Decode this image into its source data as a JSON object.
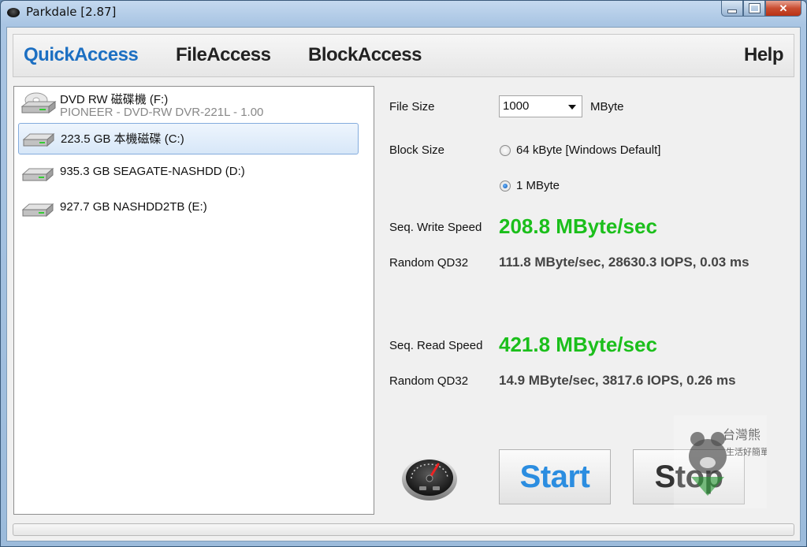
{
  "window": {
    "title": "Parkdale [2.87]"
  },
  "tabs": [
    {
      "label": "QuickAccess",
      "active": true
    },
    {
      "label": "FileAccess"
    },
    {
      "label": "BlockAccess"
    }
  ],
  "help_label": "Help",
  "drives": [
    {
      "name": "DVD RW 磁碟機 (F:)",
      "sub": "PIONEER - DVD-RW  DVR-221L - 1.00",
      "icon": "dvd-drive-icon"
    },
    {
      "name": "223.5 GB 本機磁碟 (C:)",
      "icon": "hard-disk-icon",
      "selected": true
    },
    {
      "name": "935.3 GB SEAGATE-NASHDD (D:)",
      "icon": "hard-disk-icon"
    },
    {
      "name": "927.7 GB NASHDD2TB (E:)",
      "icon": "hard-disk-icon"
    }
  ],
  "settings": {
    "file_size_label": "File Size",
    "file_size_value": "1000",
    "file_size_unit": "MByte",
    "block_size_label": "Block Size",
    "block_options": [
      {
        "label": "64 kByte [Windows Default]",
        "checked": false
      },
      {
        "label": "1 MByte",
        "checked": true
      }
    ]
  },
  "results": {
    "seq_write_label": "Seq. Write Speed",
    "seq_write_value": "208.8 MByte/sec",
    "random_write_label": "Random QD32",
    "random_write_value": "111.8 MByte/sec, 28630.3 IOPS, 0.03 ms",
    "seq_read_label": "Seq. Read Speed",
    "seq_read_value": "421.8 MByte/sec",
    "random_read_label": "Random QD32",
    "random_read_value": "14.9 MByte/sec, 3817.6 IOPS, 0.26 ms"
  },
  "buttons": {
    "start_label": "Start",
    "stop_label": "Stop"
  },
  "progress": {
    "fraction": 0
  },
  "watermark": {
    "text": "台灣熊生活好簡單",
    "icon": "bear-watermark-icon"
  },
  "colors": {
    "accent": "#1c6fc2",
    "speed_green": "#1bbf1b",
    "start_blue": "#2b8de0"
  }
}
